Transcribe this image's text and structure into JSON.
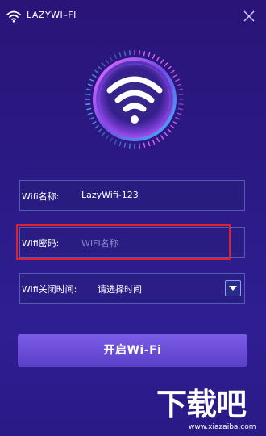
{
  "window": {
    "title": "LAZYWI–FI",
    "icons": {
      "app": "wifi-icon",
      "close": "close-icon"
    }
  },
  "hero": {
    "icon": "wifi-icon"
  },
  "form": {
    "wifi_name": {
      "label": "Wifi名称:",
      "value": "LazyWifi-123"
    },
    "wifi_password": {
      "label": "Wifi密码:",
      "placeholder": "WIFI名称"
    },
    "close_time": {
      "label": "Wifi关闭时间:",
      "selected": "请选择时间"
    }
  },
  "actions": {
    "start_label": "开启Wi-Fi"
  },
  "watermark": {
    "text": "下载吧",
    "url": "www.xiazaiba.com"
  },
  "colors": {
    "background": "#2b1a86",
    "button": "#6a4dd6",
    "highlight": "#e0202a",
    "placeholder": "#8b86c9"
  }
}
